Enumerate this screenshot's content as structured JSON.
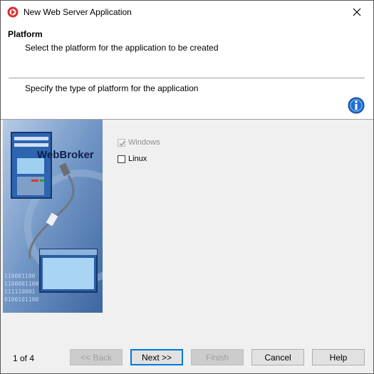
{
  "window": {
    "title": "New Web Server Application"
  },
  "header": {
    "title": "Platform",
    "subtitle": "Select the platform for the application to be created",
    "description": "Specify the type of platform for the application"
  },
  "side_image": {
    "brand_text": "WebBroker",
    "binary_text": [
      "110001100",
      "1100001100",
      "111110001",
      "0100101100"
    ]
  },
  "platforms": [
    {
      "label": "Windows",
      "checked": true,
      "enabled": false
    },
    {
      "label": "Linux",
      "checked": false,
      "enabled": true
    }
  ],
  "footer": {
    "page_indicator": "1 of 4"
  },
  "buttons": {
    "back": "<< Back",
    "next": "Next >>",
    "finish": "Finish",
    "cancel": "Cancel",
    "help": "Help"
  },
  "icons": {
    "app": "delphi-logo-icon",
    "close": "close-icon",
    "info": "info-icon"
  },
  "colors": {
    "accent": "#0078d7",
    "info_blue": "#1f6fd0",
    "app_red": "#d9302c"
  }
}
